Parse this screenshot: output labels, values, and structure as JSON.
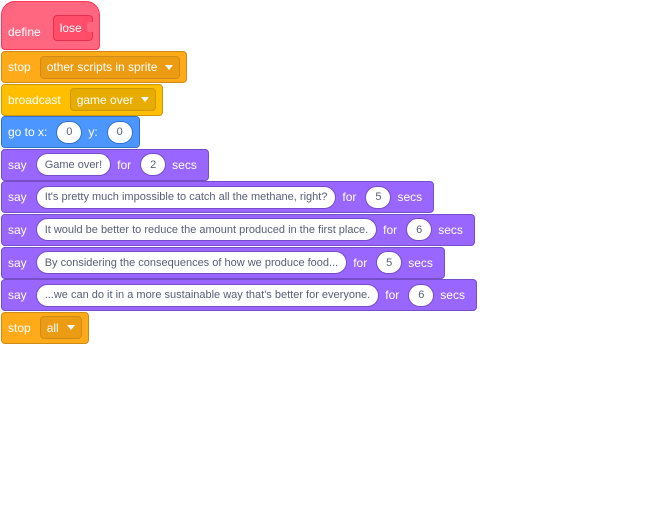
{
  "define": {
    "label": "define",
    "name": "lose"
  },
  "stop_other": {
    "label": "stop",
    "option": "other scripts in sprite"
  },
  "broadcast": {
    "label": "broadcast",
    "message": "game over"
  },
  "goto": {
    "label": "go to x:",
    "x": "0",
    "y_label": "y:",
    "y": "0"
  },
  "says": [
    {
      "label": "say",
      "text": "Game over!",
      "for": "for",
      "secs": "2",
      "unit": "secs"
    },
    {
      "label": "say",
      "text": "It's pretty much impossible to catch all the methane, right?",
      "for": "for",
      "secs": "5",
      "unit": "secs"
    },
    {
      "label": "say",
      "text": "It would be better to reduce the amount produced in the first place.",
      "for": "for",
      "secs": "6",
      "unit": "secs"
    },
    {
      "label": "say",
      "text": "By considering the consequences of how we produce food...",
      "for": "for",
      "secs": "5",
      "unit": "secs"
    },
    {
      "label": "say",
      "text": "...we can do it in a more sustainable way that's better for everyone.",
      "for": "for",
      "secs": "6",
      "unit": "secs"
    }
  ],
  "stop_all": {
    "label": "stop",
    "option": "all"
  },
  "colors": {
    "my_blocks": "#ff6680",
    "control": "#ffab19",
    "events": "#ffbf00",
    "motion": "#4c97ff",
    "looks": "#9966ff"
  }
}
